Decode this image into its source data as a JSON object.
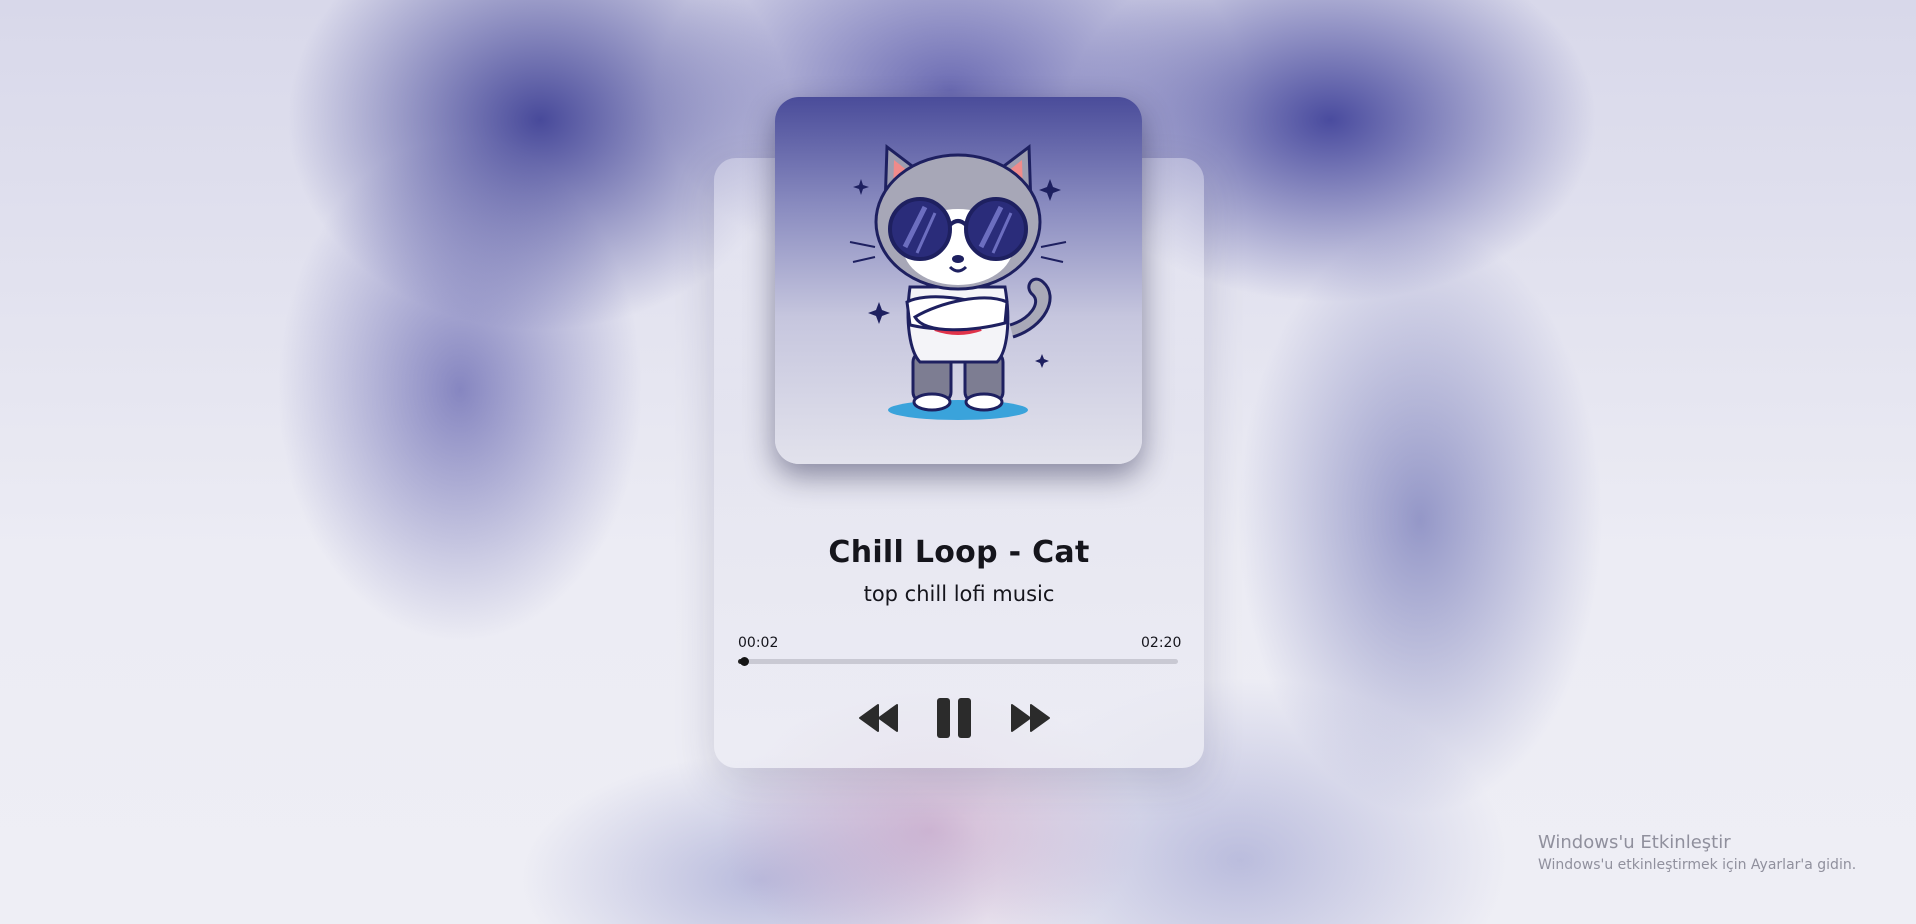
{
  "track": {
    "title": "Chill Loop - Cat",
    "artist": "top chill lofi music",
    "cover_icon": "cool-cat-sunglasses-illustration"
  },
  "playback": {
    "current_time": "00:02",
    "total_time": "02:20",
    "progress": 0.014,
    "state": "playing"
  },
  "controls": {
    "previous_icon": "rewind-icon",
    "pause_icon": "pause-icon",
    "next_icon": "fast-forward-icon"
  },
  "watermark": {
    "title": "Windows'u Etkinleştir",
    "subtitle": "Windows'u etkinleştirmek için Ayarlar'a gidin."
  },
  "colors": {
    "background_accent": "#32348c",
    "controls": "#2b2b2b"
  }
}
